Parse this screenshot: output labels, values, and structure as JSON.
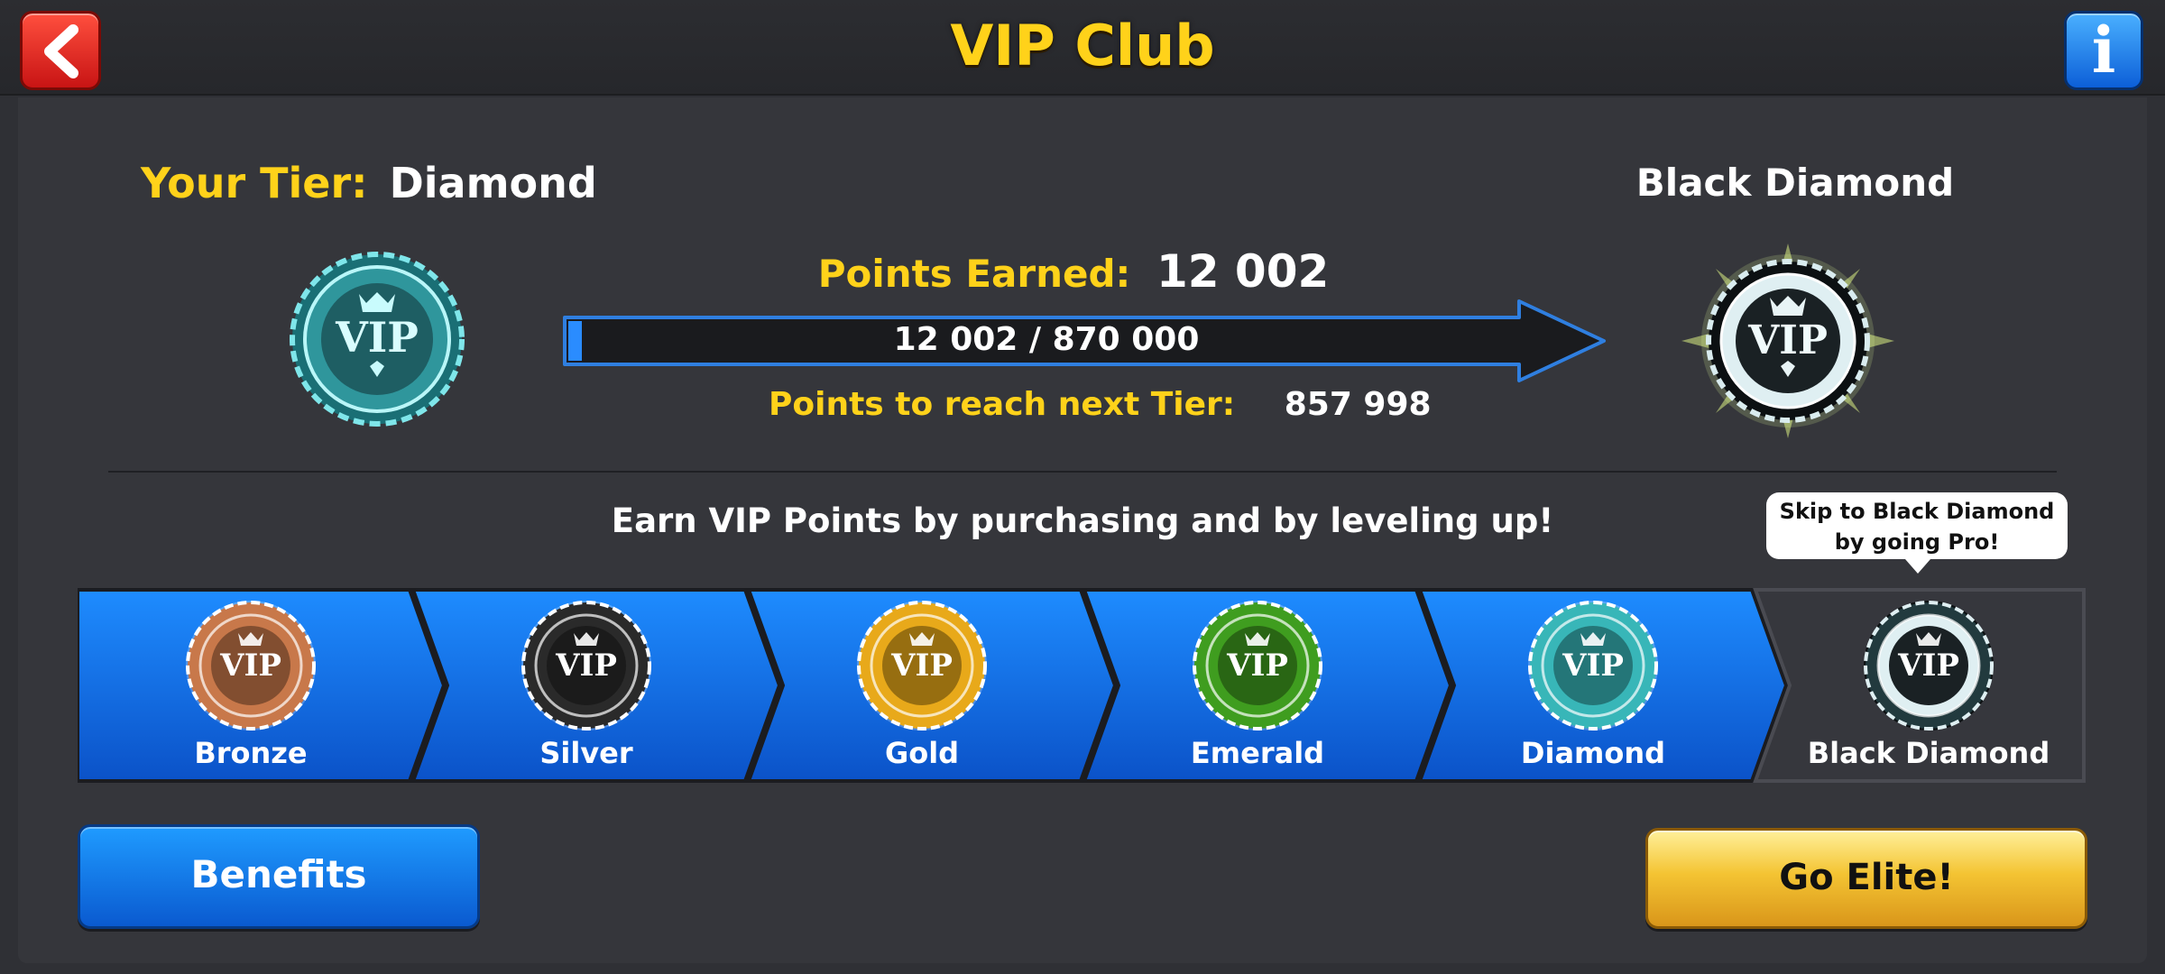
{
  "header": {
    "title": "VIP Club"
  },
  "current": {
    "tier_key": "Your Tier:",
    "tier_value": "Diamond",
    "next_tier": "Black Diamond"
  },
  "progress": {
    "earned_label": "Points Earned:",
    "earned_value": "12 002",
    "bar_text": "12 002 / 870 000",
    "fraction": 0.0138,
    "reach_label": "Points to reach next Tier:",
    "reach_value": "857 998"
  },
  "info": {
    "earn_message": "Earn VIP Points by purchasing and by leveling up!",
    "skip_line1": "Skip to Black Diamond",
    "skip_line2": "by going Pro!"
  },
  "tiers": [
    {
      "name": "Bronze",
      "color": "#c8784a"
    },
    {
      "name": "Silver",
      "color": "#2a2a2a"
    },
    {
      "name": "Gold",
      "color": "#e8a91a"
    },
    {
      "name": "Emerald",
      "color": "#3f9d1f"
    },
    {
      "name": "Diamond",
      "color": "#38b6b8"
    },
    {
      "name": "Black Diamond",
      "color": "#223a3e"
    }
  ],
  "buttons": {
    "benefits": "Benefits",
    "go_elite": "Go Elite!"
  },
  "icons": {
    "back": "chevron-left-icon",
    "info": "info-icon"
  }
}
